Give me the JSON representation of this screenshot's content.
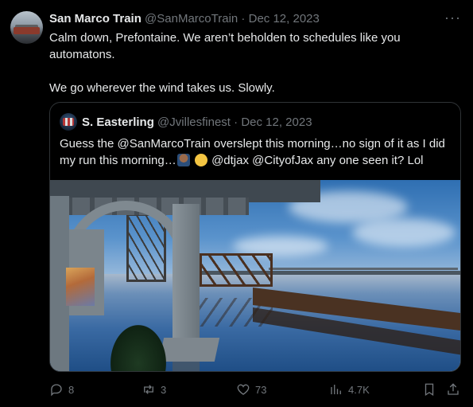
{
  "tweet": {
    "author_name": "San Marco Train",
    "author_handle": "@SanMarcoTrain",
    "separator": " · ",
    "date": "Dec 12, 2023",
    "more_label": "···",
    "text_line1": "Calm down, Prefontaine. We aren’t beholden to schedules like you automatons.",
    "text_line2": "We go wherever the wind takes us. Slowly."
  },
  "quoted": {
    "author_name": "S. Easterling",
    "author_handle": "@Jvillesfinest",
    "separator": " · ",
    "date": "Dec 12, 2023",
    "text_part1": "Guess the @SanMarcoTrain overslept this morning…no sign of it as I did my run this morning…",
    "text_part2": "@dtjax @CityofJax any one seen it? Lol"
  },
  "actions": {
    "replies": "8",
    "reposts": "3",
    "likes": "73",
    "views": "4.7K"
  },
  "icons": {
    "reply": "reply-icon",
    "repost": "repost-icon",
    "like": "heart-icon",
    "views": "views-icon",
    "bookmark": "bookmark-icon",
    "share": "share-icon"
  },
  "colors": {
    "background": "#000000",
    "text": "#e7e9ea",
    "muted": "#71767b",
    "border": "#2f3336"
  }
}
